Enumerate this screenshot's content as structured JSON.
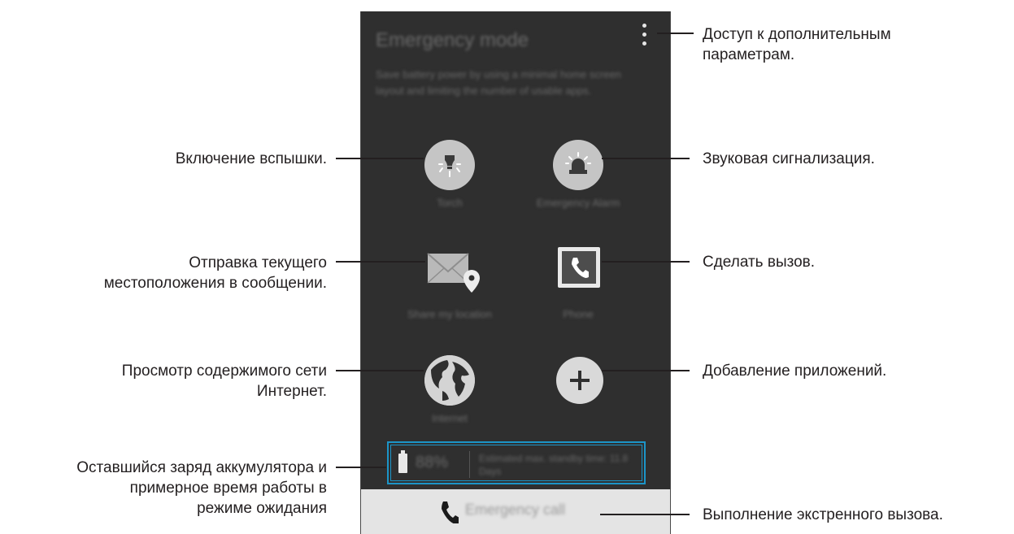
{
  "screen": {
    "title": "Emergency mode",
    "description": "Save battery power by using a minimal home screen layout and limiting the number of usable apps.",
    "apps": [
      {
        "id": "torch",
        "label": "Torch",
        "icon": "torch-icon"
      },
      {
        "id": "alarm",
        "label": "Emergency Alarm",
        "icon": "emergency-alarm-icon"
      },
      {
        "id": "share_location",
        "label": "Share my location",
        "icon": "share-location-icon"
      },
      {
        "id": "phone",
        "label": "Phone",
        "icon": "phone-icon"
      },
      {
        "id": "internet",
        "label": "Internet",
        "icon": "globe-icon"
      },
      {
        "id": "add",
        "label": "",
        "icon": "add-icon"
      }
    ],
    "battery": {
      "percent": "88%",
      "estimate": "Estimated max. standby time: 11.8 Days"
    },
    "emergency_call_label": "Emergency call"
  },
  "callouts": {
    "more_options": [
      "Доступ к дополнительным",
      "параметрам."
    ],
    "torch": [
      "Включение вспышки."
    ],
    "alarm": [
      "Звуковая сигнализация."
    ],
    "share_location": [
      "Отправка текущего",
      "местоположения в сообщении."
    ],
    "phone": [
      "Сделать вызов."
    ],
    "internet": [
      "Просмотр содержимого сети",
      "Интернет."
    ],
    "add": [
      "Добавление приложений."
    ],
    "battery": [
      "Оставшийся заряд аккумулятора и",
      "примерное время работы в",
      "режиме ожидания"
    ],
    "emergency_call": [
      "Выполнение экстренного вызова."
    ]
  },
  "colors": {
    "screen_bg": "#2f2f2f",
    "highlight": "#1c95c8",
    "icon_bg": "#c5c5c5"
  }
}
